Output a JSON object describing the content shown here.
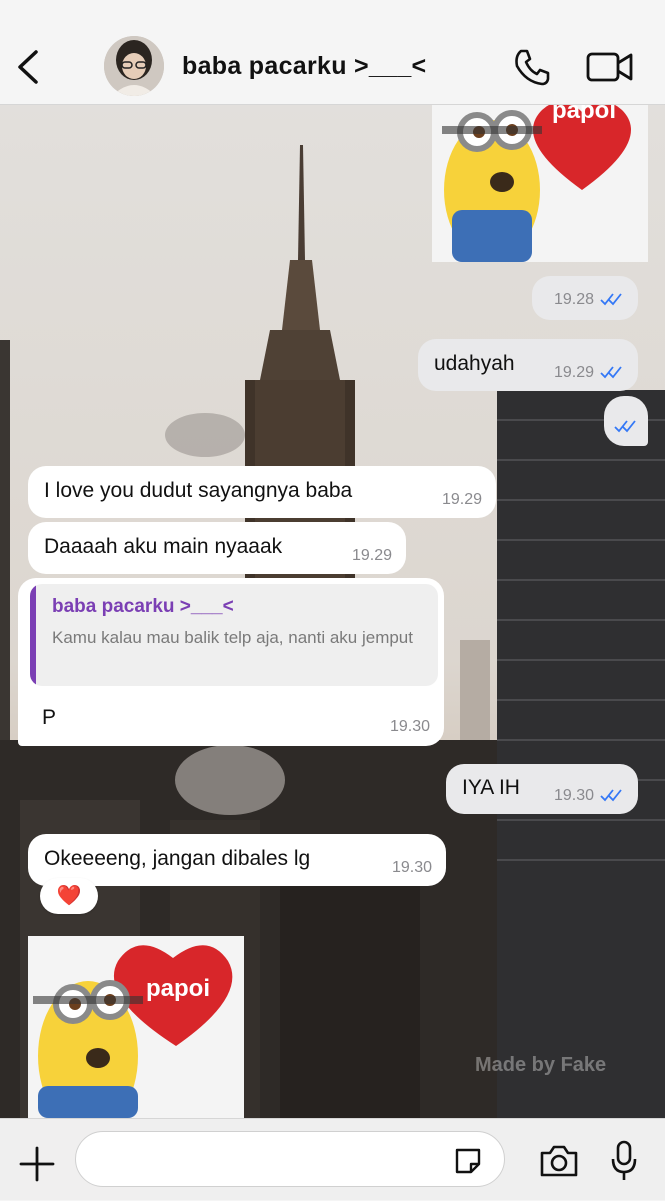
{
  "header": {
    "contact_name": "baba pacarku >___<"
  },
  "messages": [
    {
      "id": "m1",
      "direction": "outgoing",
      "type": "sticker",
      "sticker_text": "papoi"
    },
    {
      "id": "m2",
      "direction": "outgoing",
      "type": "sticker-time",
      "time": "19.28",
      "read": true
    },
    {
      "id": "m3",
      "direction": "outgoing",
      "type": "text",
      "text": "udahyah",
      "time": "19.29",
      "read": true
    },
    {
      "id": "m4",
      "direction": "outgoing",
      "type": "text",
      "text": "",
      "time": "19.29",
      "read": true
    },
    {
      "id": "m5",
      "direction": "incoming",
      "type": "text",
      "text": "I love you dudut sayangnya baba",
      "time": "19.29"
    },
    {
      "id": "m6",
      "direction": "incoming",
      "type": "text",
      "text": "Daaaah aku main nyaaak",
      "time": "19.29"
    },
    {
      "id": "m7",
      "direction": "incoming",
      "type": "reply",
      "reply_to_name": "baba pacarku >___<",
      "reply_to_text": "Kamu kalau mau balik telp aja, nanti aku jemput",
      "text": "P",
      "time": "19.30"
    },
    {
      "id": "m8",
      "direction": "outgoing",
      "type": "text",
      "text": "IYA IH",
      "time": "19.30",
      "read": true
    },
    {
      "id": "m9",
      "direction": "incoming",
      "type": "text",
      "text": "Okeeeeng, jangan dibales lg",
      "time": "19.30",
      "reaction": "❤️"
    },
    {
      "id": "m10",
      "direction": "incoming",
      "type": "sticker",
      "sticker_text": "papoi"
    }
  ],
  "watermark": "Made by Fake",
  "input": {
    "placeholder": "",
    "value": ""
  },
  "colors": {
    "header_bg": "#f6f6f6",
    "incoming_bubble": "#ffffff",
    "outgoing_bubble": "#e9e9eb",
    "read_ticks": "#3478f6",
    "reply_accent": "#7b3fb4"
  },
  "icons": {
    "back": "chevron-left-icon",
    "call": "phone-icon",
    "video": "video-camera-icon",
    "plus": "plus-icon",
    "sticker": "sticker-icon",
    "camera": "camera-icon",
    "mic": "microphone-icon"
  }
}
